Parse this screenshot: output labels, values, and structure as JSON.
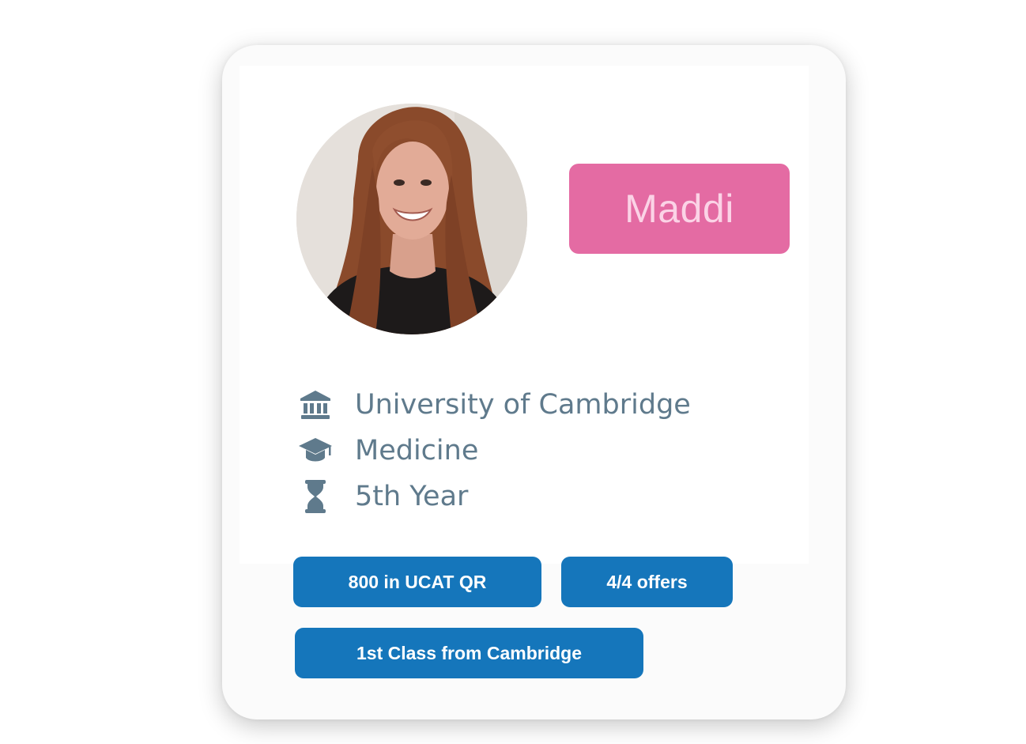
{
  "colors": {
    "name_badge_bg": "#e46ba3",
    "name_badge_text": "#fbd3e6",
    "tag_bg": "#1576bb",
    "tag_text": "#ffffff",
    "info_text": "#5f7a8c",
    "icon_color": "#5f7a8c"
  },
  "profile": {
    "name": "Maddi",
    "photo_icon": "profile-photo"
  },
  "details": [
    {
      "icon": "university-icon",
      "text": "University of Cambridge"
    },
    {
      "icon": "graduation-cap-icon",
      "text": "Medicine"
    },
    {
      "icon": "hourglass-icon",
      "text": "5th Year"
    }
  ],
  "tags": [
    {
      "label": "800 in UCAT QR"
    },
    {
      "label": "4/4 offers"
    },
    {
      "label": "1st Class from Cambridge"
    }
  ]
}
